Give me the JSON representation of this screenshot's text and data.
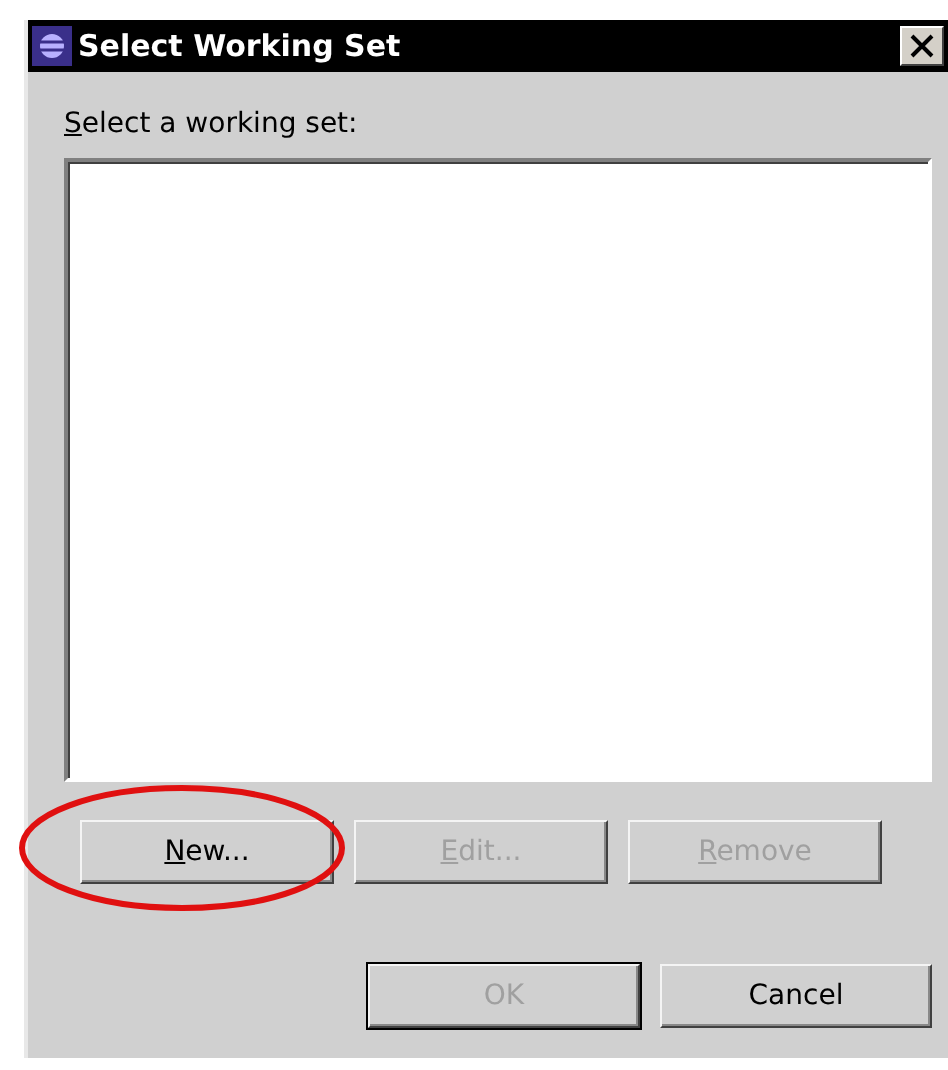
{
  "window": {
    "title": "Select Working Set"
  },
  "list_label": {
    "text": "Select a working set:",
    "mnemonic": true
  },
  "list_buttons": [
    {
      "label": "New...",
      "disabled": false,
      "mnemonic": true,
      "highlighted": true
    },
    {
      "label": "Edit...",
      "disabled": true,
      "mnemonic": true,
      "highlighted": false
    },
    {
      "label": "Remove",
      "disabled": true,
      "mnemonic": true,
      "highlighted": false
    }
  ],
  "dialog_buttons": [
    {
      "label": "OK",
      "disabled": true,
      "default": true
    },
    {
      "label": "Cancel",
      "disabled": false,
      "default": false
    }
  ]
}
